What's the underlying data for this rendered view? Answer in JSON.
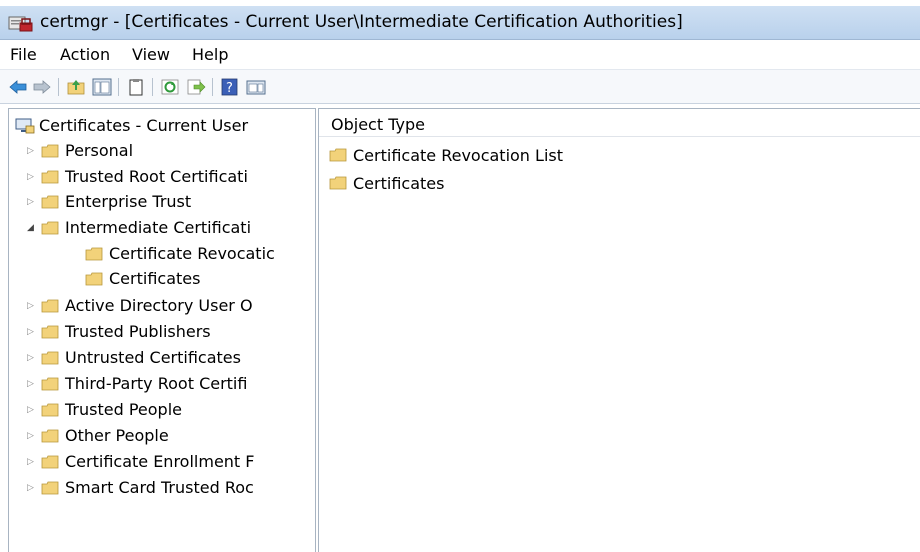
{
  "titlebar": {
    "icon": "certmgr-app-icon",
    "title": "certmgr - [Certificates - Current User\\Intermediate Certification Authorities]"
  },
  "menu": [
    "File",
    "Action",
    "View",
    "Help"
  ],
  "toolbar": {
    "icons": [
      "back-icon",
      "forward-icon",
      "up-folder-icon",
      "show-hide-console-tree-icon",
      "export-list-icon",
      "refresh-icon",
      "export-icon",
      "help-icon",
      "show-hide-action-pane-icon"
    ]
  },
  "tree": {
    "root": "Certificates - Current User",
    "items": [
      {
        "label": "Personal",
        "expanded": false
      },
      {
        "label": "Trusted Root Certificati",
        "expanded": false
      },
      {
        "label": "Enterprise Trust",
        "expanded": false
      },
      {
        "label": "Intermediate Certificati",
        "expanded": true,
        "selected": true
      },
      {
        "label": "Certificate Revocatic",
        "child": true
      },
      {
        "label": "Certificates",
        "child": true
      },
      {
        "label": "Active Directory User O",
        "expanded": false
      },
      {
        "label": "Trusted Publishers",
        "expanded": false
      },
      {
        "label": "Untrusted Certificates",
        "expanded": false
      },
      {
        "label": "Third-Party Root Certifi",
        "expanded": false
      },
      {
        "label": "Trusted People",
        "expanded": false
      },
      {
        "label": "Other People",
        "expanded": false
      },
      {
        "label": "Certificate Enrollment F",
        "expanded": false
      },
      {
        "label": "Smart Card Trusted Roc",
        "expanded": false
      }
    ]
  },
  "list": {
    "column_header": "Object Type",
    "items": [
      "Certificate Revocation List",
      "Certificates"
    ]
  },
  "colors": {
    "titlebar": "#c4d8ef",
    "folder": "#f2d27a",
    "border": "#a8b4c2"
  }
}
